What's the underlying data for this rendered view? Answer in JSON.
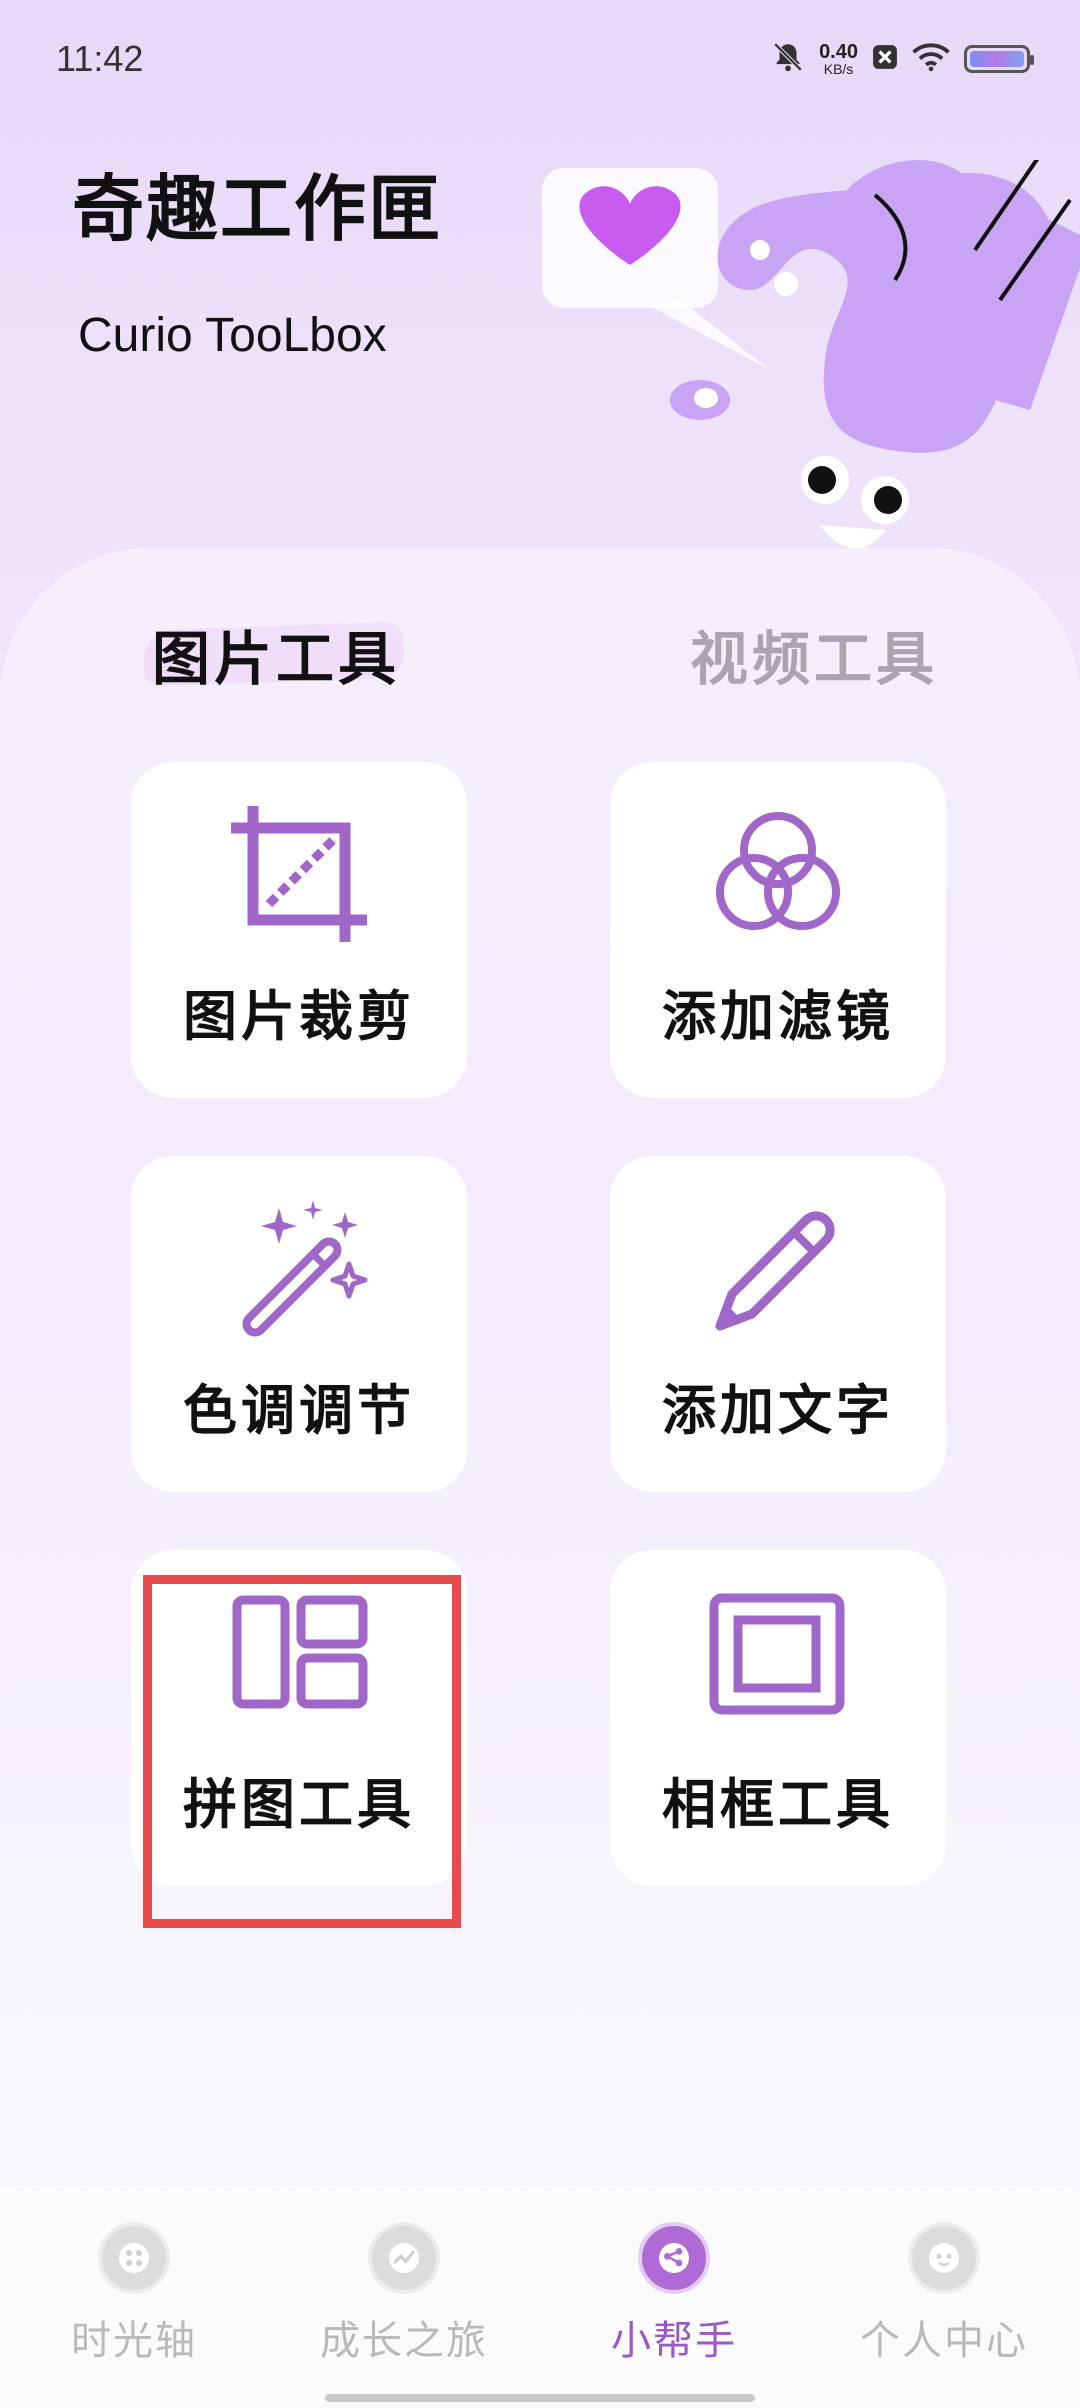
{
  "status_bar": {
    "time": "11:42",
    "net_speed_value": "0.40",
    "net_speed_unit": "KB/s",
    "icons": [
      "mute-bell-icon",
      "close-notification-icon",
      "wifi-icon",
      "battery-icon"
    ]
  },
  "header": {
    "title": "奇趣工作匣",
    "subtitle": "Curio TooLbox"
  },
  "tabs": [
    {
      "label": "图片工具",
      "active": true
    },
    {
      "label": "视频工具",
      "active": false
    }
  ],
  "tools": [
    {
      "label": "图片裁剪",
      "icon": "crop-icon"
    },
    {
      "label": "添加滤镜",
      "icon": "filter-circles-icon"
    },
    {
      "label": "色调调节",
      "icon": "magic-wand-icon"
    },
    {
      "label": "添加文字",
      "icon": "pencil-icon"
    },
    {
      "label": "拼图工具",
      "icon": "collage-layout-icon"
    },
    {
      "label": "相框工具",
      "icon": "photo-frame-icon"
    }
  ],
  "bottom_nav": [
    {
      "label": "时光轴",
      "icon": "timeline-icon",
      "active": false
    },
    {
      "label": "成长之旅",
      "icon": "growth-chart-icon",
      "active": false
    },
    {
      "label": "小帮手",
      "icon": "helper-icon",
      "active": true
    },
    {
      "label": "个人中心",
      "icon": "profile-icon",
      "active": false
    }
  ],
  "colors": {
    "accent": "#9b59c6",
    "icon_purple": "#a066c8",
    "highlight": "#e84b4b",
    "inactive": "#a9a4ad"
  }
}
